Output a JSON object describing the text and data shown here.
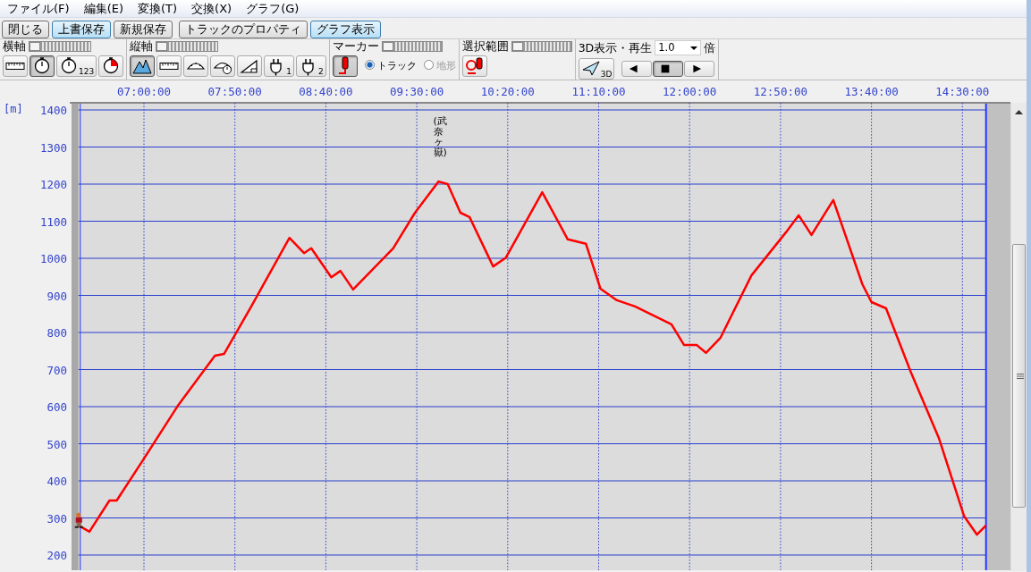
{
  "menu": [
    {
      "label": "ファイル(F)"
    },
    {
      "label": "編集(E)"
    },
    {
      "label": "変換(T)"
    },
    {
      "label": "交換(X)"
    },
    {
      "label": "グラフ(G)"
    }
  ],
  "buttons": [
    {
      "label": "閉じる",
      "active": false
    },
    {
      "label": "上書保存",
      "active": true
    },
    {
      "label": "新規保存",
      "active": false
    },
    {
      "label": "トラックのプロパティ",
      "active": false
    },
    {
      "label": "グラフ表示",
      "active": true
    }
  ],
  "toolbar": {
    "groups": [
      {
        "label": "横軸",
        "slider": {
          "level": 0
        },
        "tools": [
          {
            "kind": "ruler",
            "selected": false
          },
          {
            "kind": "stopwatch",
            "selected": true
          },
          {
            "kind": "stopwatch",
            "sub": "123",
            "selected": false
          },
          {
            "kind": "stopwatch-red",
            "selected": false
          }
        ]
      },
      {
        "label": "縦軸",
        "slider": {
          "level": 0
        },
        "tools": [
          {
            "kind": "mountain",
            "selected": true
          },
          {
            "kind": "ruler",
            "selected": false
          },
          {
            "kind": "gauge",
            "selected": false
          },
          {
            "kind": "gauge-clock",
            "selected": false
          },
          {
            "kind": "slope",
            "selected": false
          },
          {
            "kind": "plug",
            "sub": "1",
            "selected": false
          },
          {
            "kind": "plug",
            "sub": "2",
            "selected": false
          }
        ]
      },
      {
        "label": "マーカー",
        "slider": {
          "level": 0
        },
        "tools": [
          {
            "kind": "marker",
            "selected": true
          }
        ],
        "radios": [
          {
            "label": "トラック",
            "selected": true,
            "disabled": false
          },
          {
            "label": "地形",
            "selected": false,
            "disabled": true
          }
        ]
      },
      {
        "label": "選択範囲",
        "slider": {
          "level": 0
        },
        "tools": [
          {
            "kind": "range-marker",
            "selected": false
          }
        ]
      },
      {
        "label": "3D表示・再生",
        "speed": {
          "value": "1.0",
          "unit": "倍"
        },
        "tools": [
          {
            "kind": "plane",
            "sub": "3D",
            "selected": false
          }
        ],
        "player": [
          {
            "kind": "prev",
            "selected": false
          },
          {
            "kind": "stop",
            "selected": true
          },
          {
            "kind": "next",
            "selected": false
          }
        ]
      }
    ]
  },
  "chart": {
    "chart_data": {
      "type": "line",
      "ylabel": "[m]",
      "x": [
        384,
        390,
        401,
        405,
        420,
        439,
        459,
        464,
        479,
        500,
        508,
        512,
        523,
        528,
        535,
        557,
        569,
        582,
        587,
        594,
        599,
        612,
        619,
        639,
        653,
        663,
        671,
        680,
        690,
        710,
        717,
        724,
        729,
        737,
        754,
        773,
        780,
        787,
        799,
        815,
        820,
        828,
        842,
        857,
        871,
        878,
        883
      ],
      "grid": true,
      "series": [
        {
          "color": "#ff0000",
          "values": [
            280,
            263,
            347,
            347,
            460,
            605,
            737,
            742,
            870,
            1055,
            1014,
            1027,
            949,
            966,
            916,
            1027,
            1123,
            1207,
            1200,
            1123,
            1111,
            978,
            1002,
            1178,
            1051,
            1039,
            918,
            887,
            870,
            822,
            766,
            766,
            745,
            786,
            954,
            1070,
            1116,
            1063,
            1157,
            930,
            882,
            865,
            689,
            516,
            304,
            255,
            280
          ]
        }
      ],
      "xlim": [
        384,
        883
      ],
      "ylim": [
        159,
        1419
      ],
      "xticks": [
        {
          "value": 420,
          "label": "07:00:00"
        },
        {
          "value": 470,
          "label": "07:50:00"
        },
        {
          "value": 520,
          "label": "08:40:00"
        },
        {
          "value": 570,
          "label": "09:30:00"
        },
        {
          "value": 620,
          "label": "10:20:00"
        },
        {
          "value": 670,
          "label": "11:10:00"
        },
        {
          "value": 720,
          "label": "12:00:00"
        },
        {
          "value": 770,
          "label": "12:50:00"
        },
        {
          "value": 820,
          "label": "13:40:00"
        },
        {
          "value": 870,
          "label": "14:30:00"
        }
      ],
      "yticks": [
        200,
        300,
        400,
        500,
        600,
        700,
        800,
        900,
        1000,
        1100,
        1200,
        1300,
        1400
      ],
      "annotations": [
        {
          "x": 582,
          "y": 1207,
          "text": "(武奈ヶ嶽)"
        }
      ]
    }
  }
}
